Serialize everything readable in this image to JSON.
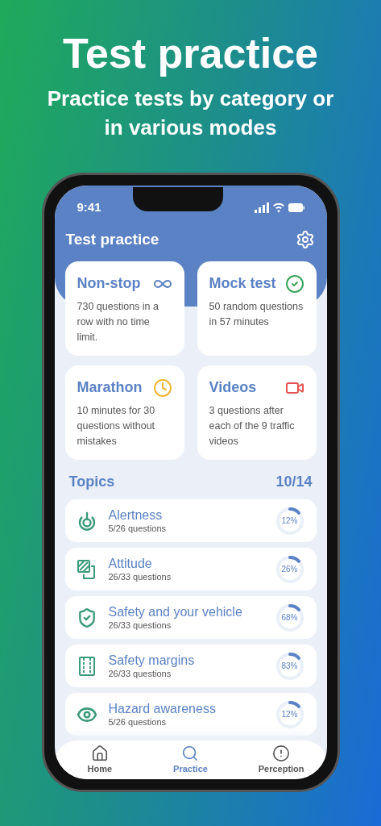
{
  "headline": "Test practice",
  "subheadline": "Practice tests by category or in various modes",
  "status_bar": {
    "time": "9:41"
  },
  "header": {
    "title": "Test practice"
  },
  "modes": [
    {
      "kind": "infinity",
      "title": "Non-stop",
      "description": "730 questions in a row with no time limit.",
      "color": "#5b82c4"
    },
    {
      "kind": "check",
      "title": "Mock test",
      "description": "50 random questions in 57 minutes",
      "color": "#3aa45c"
    },
    {
      "kind": "clock",
      "title": "Marathon",
      "description": "10 minutes for 30 questions without mistakes",
      "color": "#f2b632"
    },
    {
      "kind": "video",
      "title": "Videos",
      "description": "3 questions after each of the 9 traffic videos",
      "color": "#e55353"
    }
  ],
  "topics_header": {
    "title": "Topics",
    "count": "10/14"
  },
  "topics": [
    {
      "kind": "alert",
      "name": "Alertness",
      "questions": "5/26 questions",
      "percent": "12%"
    },
    {
      "kind": "attitude",
      "name": "Attitude",
      "questions": "26/33 questions",
      "percent": "26%"
    },
    {
      "kind": "shield",
      "name": "Safety and your vehicle",
      "questions": "26/33 questions",
      "percent": "68%"
    },
    {
      "kind": "margins",
      "name": "Safety margins",
      "questions": "26/33 questions",
      "percent": "83%"
    },
    {
      "kind": "eye",
      "name": "Hazard awareness",
      "questions": "5/26 questions",
      "percent": "12%"
    }
  ],
  "nav": [
    {
      "kind": "home",
      "label": "Home",
      "selected": false
    },
    {
      "kind": "search",
      "label": "Practice",
      "selected": true
    },
    {
      "kind": "alert",
      "label": "Perception",
      "selected": false
    }
  ]
}
